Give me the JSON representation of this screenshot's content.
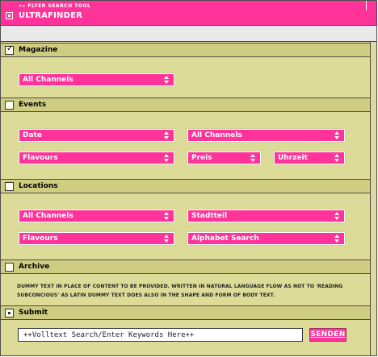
{
  "window": {
    "subtitle": "FLYER SEARCH TOOL",
    "subtitle_prefix": "»»",
    "title": "ULTRAFINDER"
  },
  "sections": {
    "magazine": {
      "label": "Magazine",
      "checked": true,
      "channel": "All Channels"
    },
    "events": {
      "label": "Events",
      "checked": false,
      "date": "Date",
      "channel": "All Channels",
      "flavours": "Flavours",
      "preis": "Preis",
      "uhrzeit": "Uhrzeit"
    },
    "locations": {
      "label": "Locations",
      "checked": false,
      "channel": "All Channels",
      "stadtteil": "Stadtteil",
      "flavours": "Flavours",
      "alphabet": "Alphabet Search"
    },
    "archive": {
      "label": "Archive",
      "checked": false,
      "text": "DUMMY TEXT IN PLACE OF CONTENT TO BE PROVIDED. WRITTEN IN NATURAL LANGUAGE FLOW AS NOT TO 'READING SUBCONCIOUS' AS LATIN DUMMY TEXT DOES ALSO IN THE SHAPE AND FORM OF BODY TEXT."
    },
    "submit": {
      "label": "Submit",
      "search_value": "++Volltext Search/Enter Keywords Here++",
      "send_label": "SENDEN"
    }
  },
  "colors": {
    "accent": "#ff3399",
    "panel": "#dcdb98",
    "header": "#cfcd82"
  },
  "icons": {
    "title_box": "square-checkbox-icon",
    "dropdown_arrow": "updown-arrow-icon"
  }
}
